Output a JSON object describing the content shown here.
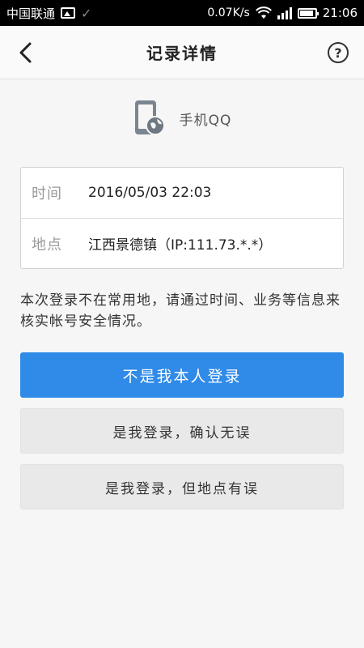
{
  "status_bar": {
    "carrier": "中国联通",
    "speed": "0.07K/s",
    "time": "21:06",
    "battery_level": 0.9
  },
  "header": {
    "title": "记录详情",
    "help_label": "?"
  },
  "app": {
    "name": "手机QQ"
  },
  "record": {
    "time_label": "时间",
    "time_value": "2016/05/03 22:03",
    "location_label": "地点",
    "location_value": "江西景德镇（IP:111.73.*.*）"
  },
  "notice": "本次登录不在常用地，请通过时间、业务等信息来核实帐号安全情况。",
  "actions": {
    "not_me": "不是我本人登录",
    "confirm": "是我登录，确认无误",
    "wrong_location": "是我登录，但地点有误"
  },
  "colors": {
    "primary": "#2f8ae8",
    "secondary": "#e9e9e9"
  }
}
